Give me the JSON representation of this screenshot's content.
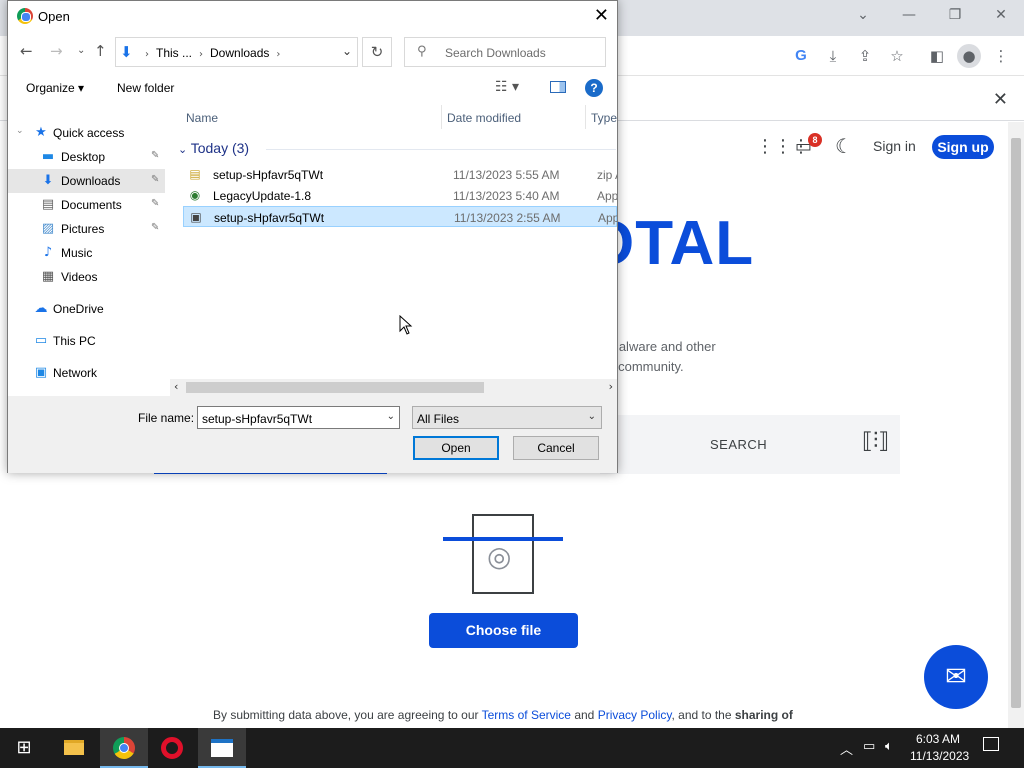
{
  "browser": {
    "window_controls": [
      "⌄",
      "—",
      "❐",
      "✕"
    ],
    "toolbar_icons": [
      "google-icon",
      "download-icon",
      "share-icon",
      "star-icon",
      "sidepanel-icon",
      "profile-icon",
      "menu-icon"
    ],
    "infobar_close": "✕"
  },
  "vt": {
    "header": {
      "notif_count": "8",
      "signin": "Sign in",
      "signup": "Sign up"
    },
    "logo": "OTAL",
    "tagline1": "malware and other",
    "tagline2": "y community.",
    "search_label": "SEARCH",
    "choose_file": "Choose file",
    "terms": {
      "prefix": "By submitting data above, you are agreeing to our ",
      "tos": "Terms of Service",
      "and": " and ",
      "privacy": "Privacy Policy",
      "suffix": ", and to the ",
      "bold": "sharing of"
    },
    "accent": "#0b4dda"
  },
  "dialog": {
    "title": "Open",
    "address": {
      "part1": "This ...",
      "part2": "Downloads"
    },
    "search_placeholder": "Search Downloads",
    "organize": "Organize ▾",
    "new_folder": "New folder",
    "nav_items": [
      {
        "label": "Quick access",
        "icon": "star-icon"
      },
      {
        "label": "Desktop",
        "icon": "desktop-icon"
      },
      {
        "label": "Downloads",
        "icon": "download-icon"
      },
      {
        "label": "Documents",
        "icon": "documents-icon"
      },
      {
        "label": "Pictures",
        "icon": "pictures-icon"
      },
      {
        "label": "Music",
        "icon": "music-icon"
      },
      {
        "label": "Videos",
        "icon": "videos-icon"
      },
      {
        "label": "OneDrive",
        "icon": "cloud-icon"
      },
      {
        "label": "This PC",
        "icon": "computer-icon"
      },
      {
        "label": "Network",
        "icon": "network-icon"
      }
    ],
    "columns": {
      "name": "Name",
      "date": "Date modified",
      "type": "Type"
    },
    "group": "Today (3)",
    "files": [
      {
        "name": "setup-sHpfavr5qTWt",
        "date": "11/13/2023 5:55 AM",
        "type": "zip Ar",
        "icon": "zip-icon",
        "selected": false
      },
      {
        "name": "LegacyUpdate-1.8",
        "date": "11/13/2023 5:40 AM",
        "type": "Appli",
        "icon": "globe-icon",
        "selected": false
      },
      {
        "name": "setup-sHpfavr5qTWt",
        "date": "11/13/2023 2:55 AM",
        "type": "Appli",
        "icon": "installer-icon",
        "selected": true
      }
    ],
    "file_name_label": "File name:",
    "file_name_value": "setup-sHpfavr5qTWt",
    "file_type_value": "All Files",
    "open_btn": "Open",
    "cancel_btn": "Cancel"
  },
  "taskbar": {
    "time": "6:03 AM",
    "date": "11/13/2023"
  }
}
